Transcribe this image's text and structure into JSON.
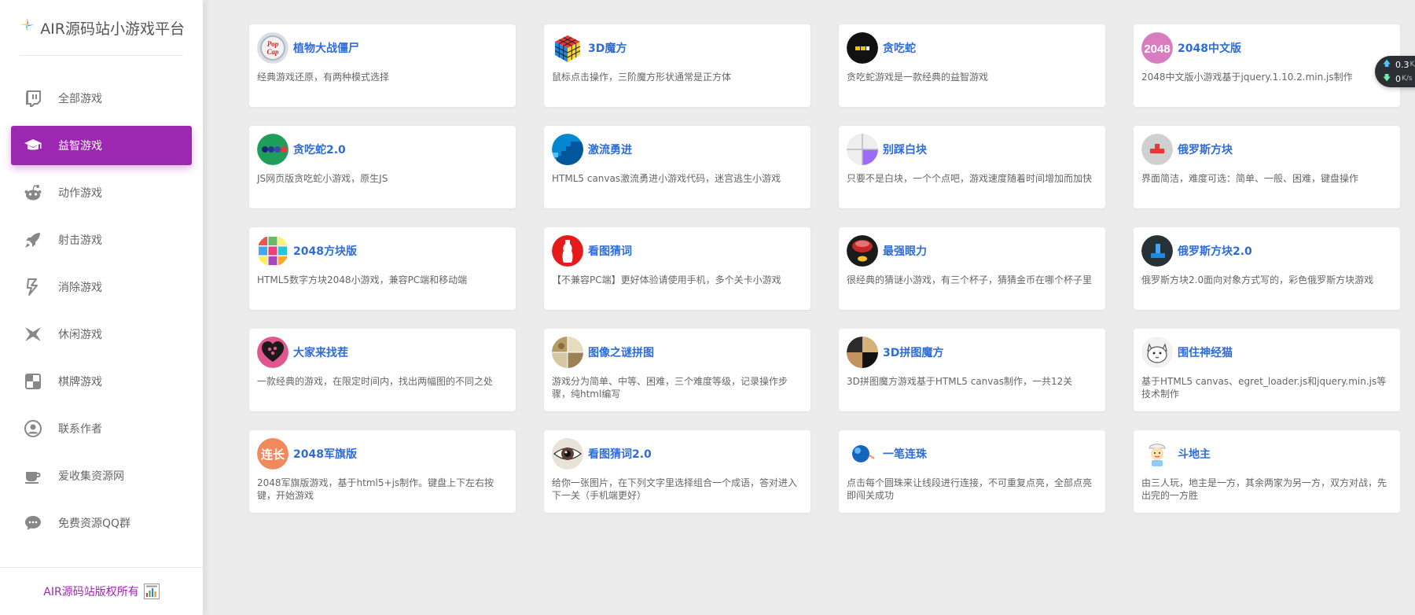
{
  "brand": {
    "title": "AIR源码站小游戏平台",
    "logo_icon": "colorful-star-icon"
  },
  "sidebar": {
    "items": [
      {
        "label": "全部游戏",
        "icon": "twitch-icon",
        "active": false
      },
      {
        "label": "益智游戏",
        "icon": "graduation-cap-icon",
        "active": true
      },
      {
        "label": "动作游戏",
        "icon": "reddit-robot-icon",
        "active": false
      },
      {
        "label": "射击游戏",
        "icon": "rocket-icon",
        "active": false
      },
      {
        "label": "消除游戏",
        "icon": "zap-icon",
        "active": false
      },
      {
        "label": "休闲游戏",
        "icon": "origami-icon",
        "active": false
      },
      {
        "label": "棋牌游戏",
        "icon": "chess-board-icon",
        "active": false
      },
      {
        "label": "联系作者",
        "icon": "user-circle-icon",
        "active": false
      },
      {
        "label": "爱收集资源网",
        "icon": "coffee-cup-icon",
        "active": false
      },
      {
        "label": "免费资源QQ群",
        "icon": "chat-bubble-icon",
        "active": false
      }
    ],
    "footer_text": "AIR源码站版权所有",
    "footer_icon": "cnzz-stats-icon"
  },
  "games": [
    {
      "title": "植物大战僵尸",
      "desc": "经典游戏还原，有两种模式选择",
      "icon": "popcap-icon"
    },
    {
      "title": "3D魔方",
      "desc": "鼠标点击操作，三阶魔方形状通常是正方体",
      "icon": "rubiks-cube-icon"
    },
    {
      "title": "贪吃蛇",
      "desc": "贪吃蛇游戏是一款经典的益智游戏",
      "icon": "snake-icon"
    },
    {
      "title": "2048中文版",
      "desc": "2048中文版小游戏基于jquery.1.10.2.min.js制作",
      "icon": "2048-icon"
    },
    {
      "title": "贪吃蛇2.0",
      "desc": "JS网页版贪吃蛇小游戏，原生JS",
      "icon": "snake-dots-icon"
    },
    {
      "title": "激流勇进",
      "desc": "HTML5 canvas激流勇进小游戏代码，迷宫逃生小游戏",
      "icon": "stairs-icon"
    },
    {
      "title": "别踩白块",
      "desc": "只要不是白块，一个个点吧，游戏速度随着时间增加而加快",
      "icon": "tiles-icon"
    },
    {
      "title": "俄罗斯方块",
      "desc": "界面简洁，难度可选：简单、一般、困难，键盘操作",
      "icon": "tetris-icon"
    },
    {
      "title": "2048方块版",
      "desc": "HTML5数字方块2048小游戏，兼容PC端和移动端",
      "icon": "color-grid-icon"
    },
    {
      "title": "看图猜词",
      "desc": "【不兼容PC端】更好体验请使用手机，多个关卡小游戏",
      "icon": "bottle-icon"
    },
    {
      "title": "最强眼力",
      "desc": "很经典的猜谜小游戏，有三个杯子，猜猜金币在哪个杯子里",
      "icon": "cup-coin-icon"
    },
    {
      "title": "俄罗斯方块2.0",
      "desc": "俄罗斯方块2.0面向对象方式写的，彩色俄罗斯方块游戏",
      "icon": "tetris-blue-icon"
    },
    {
      "title": "大家来找茬",
      "desc": "一款经典的游戏，在限定时间内，找出两幅图的不同之处",
      "icon": "heart-icon"
    },
    {
      "title": "图像之谜拼图",
      "desc": "游戏分为简单、中等、困难，三个难度等级，记录操作步骤，纯html编写",
      "icon": "puzzle-photo-icon"
    },
    {
      "title": "3D拼图魔方",
      "desc": "3D拼图魔方游戏基于HTML5 canvas制作，一共12关",
      "icon": "puzzle-cube-icon"
    },
    {
      "title": "围住神经猫",
      "desc": "基于HTML5 canvas、egret_loader.js和jquery.min.js等技术制作",
      "icon": "cat-icon"
    },
    {
      "title": "2048军旗版",
      "desc": "2048军旗版游戏，基于html5+js制作。键盘上下左右按键，开始游戏",
      "icon": "lianzhang-icon"
    },
    {
      "title": "看图猜词2.0",
      "desc": "给你一张图片，在下列文字里选择组合一个成语，答对进入下一关（手机端更好）",
      "icon": "eye-icon"
    },
    {
      "title": "一笔连珠",
      "desc": "点击每个圆珠来让线段进行连接，不可重复点亮，全部点亮即闯关成功",
      "icon": "blue-ball-icon"
    },
    {
      "title": "斗地主",
      "desc": "由三人玩，地主是一方，其余两家为另一方，双方对战，先出完的一方胜",
      "icon": "chef-boy-icon"
    }
  ],
  "speed_widget": {
    "upload": "0.3",
    "download": "0",
    "unit": "K/s"
  },
  "colors": {
    "accent": "#9c27b0",
    "title_blue": "#2f6cd6",
    "background": "#ececec"
  }
}
